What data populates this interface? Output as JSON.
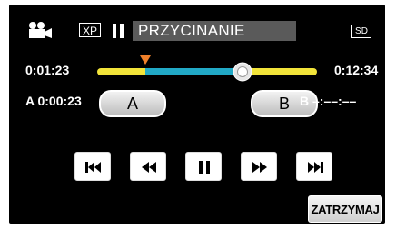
{
  "header": {
    "mode_icon": "video-camera-icon",
    "quality": "XP",
    "pause_icon": "pause-icon",
    "title": "PRZYCINANIE",
    "media": "SD"
  },
  "timeline": {
    "current_time": "0:01:23",
    "total_time": "0:12:34",
    "marker_a_position": 0.22,
    "playhead_position": 0.66,
    "colors": {
      "outside": "#f2e43a",
      "selected": "#21a9c6",
      "marker": "#f0802a"
    }
  },
  "points": {
    "a_label": "A",
    "a_time": "0:00:23",
    "a_button": "A",
    "b_button": "B",
    "b_label": "B",
    "b_time": "–:––:––"
  },
  "controls": [
    {
      "icon": "skip-to-start-icon"
    },
    {
      "icon": "rewind-icon"
    },
    {
      "icon": "pause-icon"
    },
    {
      "icon": "fast-forward-icon"
    },
    {
      "icon": "skip-to-end-icon"
    }
  ],
  "stop_button": "ZATRZYMAJ"
}
